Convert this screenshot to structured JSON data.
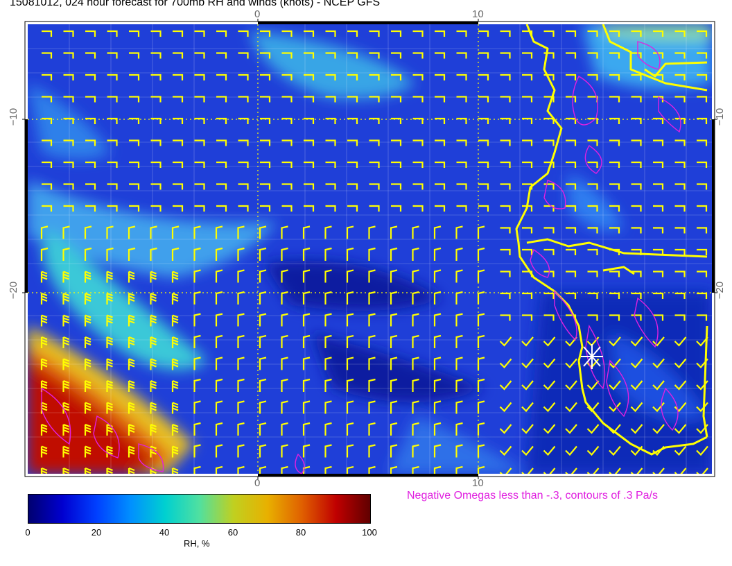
{
  "title": "15081012, 024 hour forecast for 700mb RH and winds (knots) - NCEP GFS",
  "axis_ticks": {
    "top": [
      "0",
      "10"
    ],
    "bottom": [
      "0",
      "10"
    ],
    "left": [
      "−10",
      "−20"
    ],
    "right": [
      "−10",
      "−20"
    ]
  },
  "omega_note": "Negative Omegas less than -.3, contours of .3 Pa/s",
  "colorbar": {
    "ticks": [
      "0",
      "20",
      "40",
      "60",
      "80",
      "100"
    ],
    "label": "RH, %"
  },
  "colors": {
    "wind_barbs": "#ffff00",
    "coastline": "#ffff00",
    "omega_contours": "#e020e0",
    "rh_low": "#0000a0",
    "rh_high": "#b00000"
  },
  "chart_data": {
    "type": "heatmap",
    "title": "15081012, 024 hour forecast for 700mb RH and winds (knots) - NCEP GFS",
    "variable": "RH, %",
    "scale": [
      0,
      100
    ],
    "overlays": [
      "wind barbs (knots)",
      "negative omega contours"
    ]
  }
}
